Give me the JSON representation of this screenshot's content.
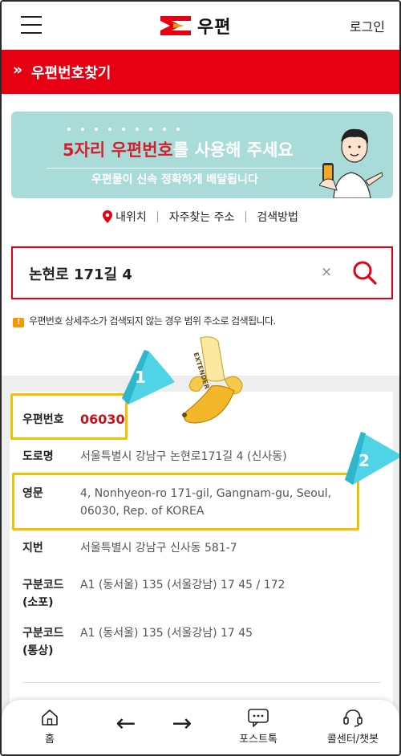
{
  "header": {
    "logo_text": "우편",
    "login_label": "로그인",
    "menu_icon": "hamburger-icon"
  },
  "titlebar": {
    "chevron": "»",
    "title": "우편번호찾기"
  },
  "banner": {
    "headline_highlight": "5자리 우편번호",
    "headline_rest": "를 사용해 주세요",
    "subline": "우편물이 신속 정확하게 배달됩니다"
  },
  "quick_links": {
    "my_location": "내위치",
    "frequent": "자주찾는 주소",
    "how_to": "검색방법"
  },
  "search": {
    "value": "논현로 171길 4",
    "clear_glyph": "×"
  },
  "notice": {
    "icon_glyph": "!",
    "text": "우편번호 상세주소가 검색되지 않는 경우 범위 주소로 검색됩니다."
  },
  "overlay": {
    "badge1": "1",
    "badge2": "2",
    "extender_text": "EXTENDER"
  },
  "result": {
    "postcode_label": "우편번호",
    "postcode_value": "06030",
    "road_label": "도로명",
    "road_value": "서울특별시 강남구 논현로171길 4 (신사동)",
    "english_label": "영문",
    "english_line1": "4, Nonhyeon-ro 171-gil, Gangnam-gu, Seoul,",
    "english_line2": "06030, Rep. of KOREA",
    "jibun_label": "지번",
    "jibun_value": "서울특별시 강남구 신사동 581-7",
    "code_small_label1": "구분코드",
    "code_small_label2": "(소포)",
    "code_small_value": "A1 (동서울) 135 (서울강남) 17 45 / 172",
    "code_normal_label1": "구분코드",
    "code_normal_label2": "(통상)",
    "code_normal_value": "A1 (동서울) 135 (서울강남) 17 45"
  },
  "bottom_nav": {
    "home": "홈",
    "back": "←",
    "forward": "→",
    "posttalk": "포스트톡",
    "callcenter": "콜센터/챗봇"
  },
  "colors": {
    "brand_red": "#e60012",
    "highlight_yellow": "#f5c000",
    "banner_teal": "#a9dbd9",
    "badge_cyan": "#4fd3e6"
  }
}
